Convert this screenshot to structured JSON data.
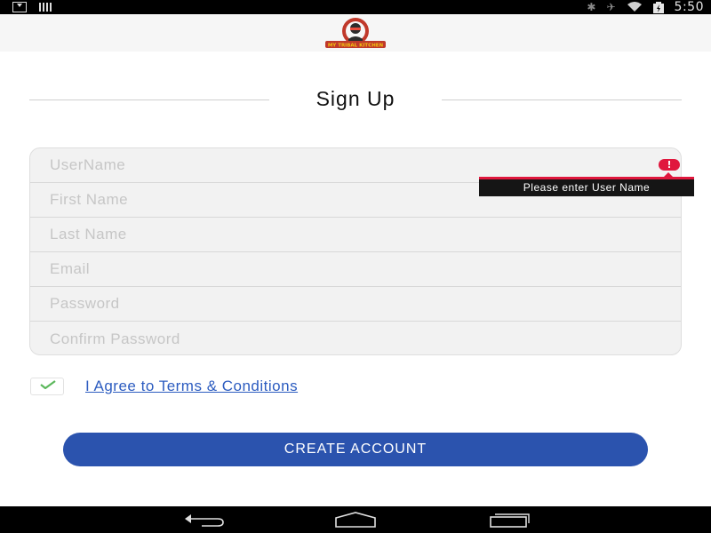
{
  "status_bar": {
    "time": "5:50",
    "icons": [
      "download-icon",
      "signal-bars-icon",
      "bluetooth-icon",
      "vibrate-icon",
      "wifi-icon",
      "battery-icon"
    ]
  },
  "header": {
    "logo_text": "MY TRIBAL KITCHEN"
  },
  "page": {
    "title": "Sign Up"
  },
  "form": {
    "fields": [
      {
        "name": "username",
        "placeholder": "UserName",
        "value": ""
      },
      {
        "name": "first_name",
        "placeholder": "First Name",
        "value": ""
      },
      {
        "name": "last_name",
        "placeholder": "Last Name",
        "value": ""
      },
      {
        "name": "email",
        "placeholder": "Email",
        "value": ""
      },
      {
        "name": "password",
        "placeholder": "Password",
        "value": ""
      },
      {
        "name": "confirm_password",
        "placeholder": "Confirm Password",
        "value": ""
      }
    ],
    "error": {
      "icon": "!",
      "message": "Please enter User Name"
    }
  },
  "terms": {
    "checked": true,
    "label": "I Agree to Terms & Conditions"
  },
  "actions": {
    "create_account_label": "CREATE ACCOUNT"
  },
  "colors": {
    "accent": "#2b53ae",
    "link": "#2c5cc0",
    "error": "#e0173d",
    "check": "#5cb85c"
  }
}
